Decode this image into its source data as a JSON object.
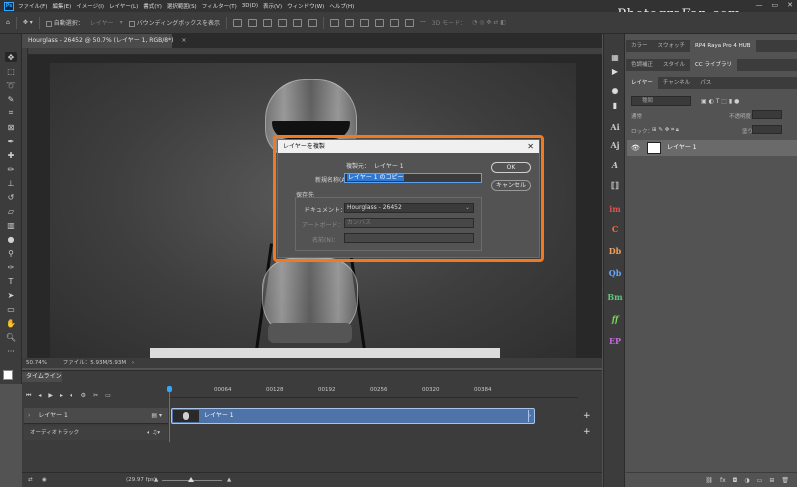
{
  "menubar": {
    "app_logo": "Ps",
    "items": [
      "ファイル(F)",
      "編集(E)",
      "イメージ(I)",
      "レイヤー(L)",
      "書式(Y)",
      "選択範囲(S)",
      "フィルター(T)",
      "3D(D)",
      "表示(V)",
      "ウィンドウ(W)",
      "ヘルプ(H)"
    ],
    "watermark": "PhotograFan.com",
    "window_controls": [
      "—",
      "▭",
      "✕"
    ]
  },
  "optionsbar": {
    "auto_select": "自動選択：",
    "auto_select_target": "レイヤー",
    "show_transform": "バウンディングボックスを表示",
    "three_d_mode": "3D モード："
  },
  "document": {
    "tab_title": "Hourglass - 26452 @ 50.7% (レイヤー 1, RGB/8*)",
    "tab_close": "×",
    "zoom": "50.74%",
    "file_info": "ファイル：5.93M/5.93M"
  },
  "dialog": {
    "title": "レイヤーを複製",
    "close": "✕",
    "source_label": "複製元：",
    "source_value": "レイヤー 1",
    "newname_label": "新規名称(A)：",
    "newname_value": "レイヤー 1 のコピー",
    "ok_label": "OK",
    "cancel_label": "キャンセル",
    "destination_header": "保存先",
    "document_label": "ドキュメント：",
    "document_value": "Hourglass - 26452",
    "artboard_label": "アートボード：",
    "artboard_value": "カンバス",
    "name_label": "名前(N)："
  },
  "timeline": {
    "tab": "タイムライン",
    "ticks": [
      "00064",
      "00128",
      "00192",
      "00256",
      "00320",
      "00384"
    ],
    "layer_track": "レイヤー 1",
    "clip_label": "レイヤー 1",
    "audio_track": "オーディオトラック",
    "fps": "(29.97 fps)"
  },
  "panels": {
    "top_tabs": [
      "カラー",
      "スウォッチ",
      "RP4 Raya Pro 4 HUB"
    ],
    "second_tabs": [
      "色調補正",
      "スタイル",
      "CC ライブラリ"
    ],
    "layer_tabs": [
      "レイヤー",
      "チャンネル",
      "パス"
    ],
    "search_kind": "種類",
    "blend_mode": "通常",
    "opacity_label": "不透明度：",
    "lock_label": "ロック：",
    "fill_label": "塗り：",
    "layer_name": "レイヤー 1"
  },
  "icon_strip": [
    "Ai",
    "Aj",
    "A",
    "im",
    "C",
    "Db",
    "Qb",
    "Bm",
    "ff",
    "EP"
  ]
}
